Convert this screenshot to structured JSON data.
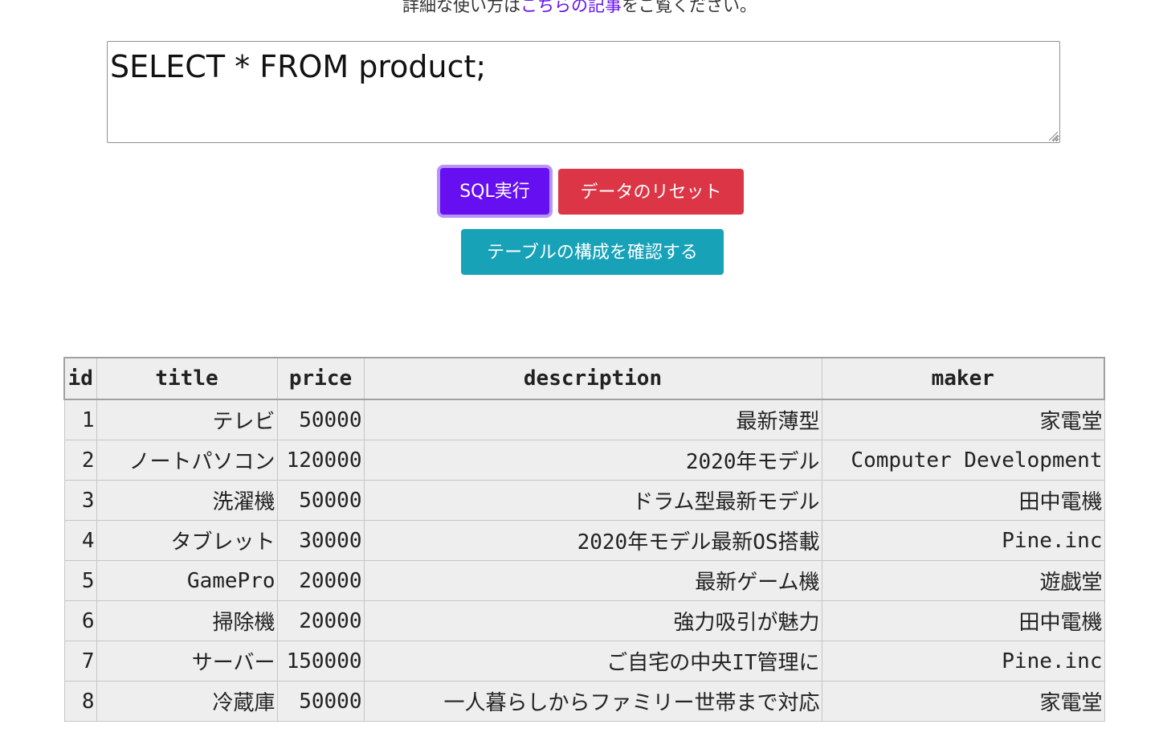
{
  "intro": {
    "before_link": "詳細な使い方は",
    "link_text": "こちらの記事",
    "after_link": "をご覧ください。"
  },
  "editor": {
    "query": "SELECT * FROM product;"
  },
  "buttons": {
    "run": "SQL実行",
    "reset": "データのリセット",
    "structure": "テーブルの構成を確認する"
  },
  "colors": {
    "run_button": "#6610f2",
    "reset_button": "#dc3545",
    "structure_button": "#17a2b8",
    "link": "#6610f2",
    "table_background": "#eeeeee"
  },
  "result": {
    "columns": [
      "id",
      "title",
      "price",
      "description",
      "maker"
    ],
    "rows": [
      [
        "1",
        "テレビ",
        "50000",
        "最新薄型",
        "家電堂"
      ],
      [
        "2",
        "ノートパソコン",
        "120000",
        "2020年モデル",
        "Computer Development"
      ],
      [
        "3",
        "洗濯機",
        "50000",
        "ドラム型最新モデル",
        "田中電機"
      ],
      [
        "4",
        "タブレット",
        "30000",
        "2020年モデル最新OS搭載",
        "Pine.inc"
      ],
      [
        "5",
        "GamePro",
        "20000",
        "最新ゲーム機",
        "遊戯堂"
      ],
      [
        "6",
        "掃除機",
        "20000",
        "強力吸引が魅力",
        "田中電機"
      ],
      [
        "7",
        "サーバー",
        "150000",
        "ご自宅の中央IT管理に",
        "Pine.inc"
      ],
      [
        "8",
        "冷蔵庫",
        "50000",
        "一人暮らしからファミリー世帯まで対応",
        "家電堂"
      ]
    ]
  }
}
